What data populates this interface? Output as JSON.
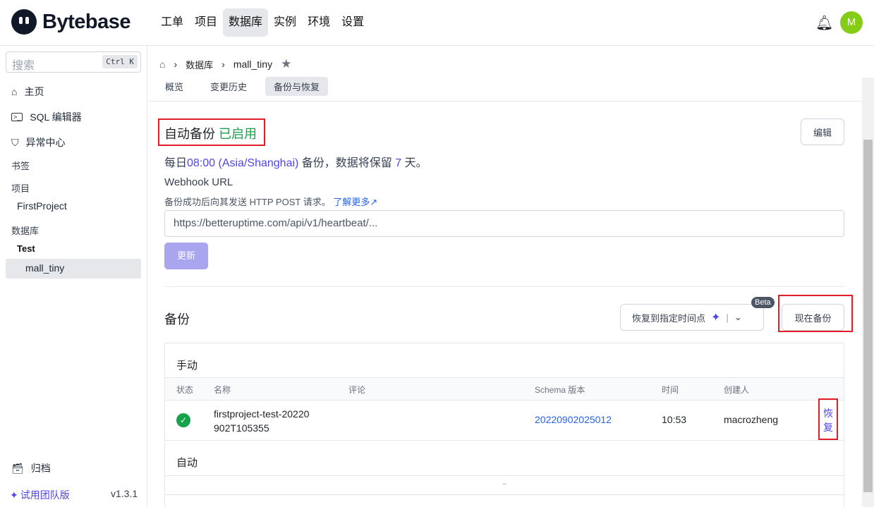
{
  "header": {
    "brand": "Bytebase",
    "nav": [
      "工单",
      "项目",
      "数据库",
      "实例",
      "环境",
      "设置"
    ],
    "active_nav": 2,
    "avatar": "M"
  },
  "sidebar": {
    "search_placeholder": "搜索",
    "shortcut": "Ctrl K",
    "items": [
      {
        "label": "主页",
        "icon": "home-icon"
      },
      {
        "label": "SQL 编辑器",
        "icon": "terminal-icon"
      },
      {
        "label": "异常中心",
        "icon": "shield-icon"
      }
    ],
    "bookmarks": "书签",
    "projects_header": "项目",
    "project": "FirstProject",
    "databases_header": "数据库",
    "env": "Test",
    "database": "mall_tiny",
    "archive": "归档",
    "trial": "试用团队版",
    "version": "v1.3.1"
  },
  "breadcrumb": {
    "section": "数据库",
    "db": "mall_tiny"
  },
  "tabs": [
    "概览",
    "变更历史",
    "备份与恢复"
  ],
  "auto_backup": {
    "title": "自动备份",
    "status": "已启用",
    "edit": "编辑",
    "schedule_prefix": "每日",
    "schedule_time": "08:00 (Asia/Shanghai)",
    "schedule_mid": "备份，数据将保留",
    "days": "7",
    "schedule_suffix": "天。",
    "webhook_label": "Webhook URL",
    "webhook_desc": "备份成功后向其发送 HTTP POST 请求。",
    "learn_more": "了解更多",
    "webhook_placeholder": "https://betteruptime.com/api/v1/heartbeat/...",
    "update": "更新"
  },
  "backups": {
    "title": "备份",
    "pitr": "恢复到指定时间点",
    "beta": "Beta",
    "backup_now": "现在备份",
    "manual": "手动",
    "auto": "自动",
    "columns": [
      "状态",
      "名称",
      "评论",
      "Schema 版本",
      "时间",
      "创建人"
    ],
    "rows": [
      {
        "name": "firstproject-test-20220902T105355",
        "comment": "",
        "version": "20220902025012",
        "time": "10:53",
        "creator": "macrozheng",
        "action": "恢复"
      }
    ],
    "auto_empty": "–"
  },
  "colors": {
    "accent": "#4f46e5",
    "success": "#16a34a",
    "highlight": "#e11d28"
  }
}
